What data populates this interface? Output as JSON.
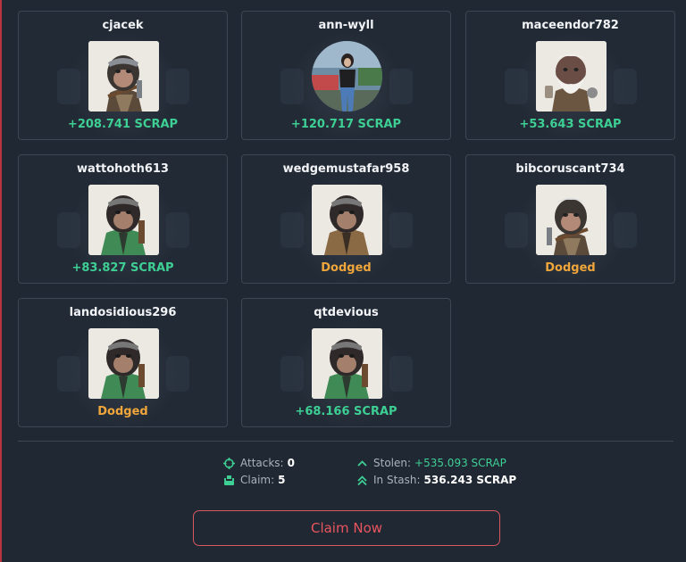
{
  "attackers": [
    {
      "username": "cjacek",
      "result": "+208.741 SCRAP",
      "status": "gain",
      "avatar": "ape-pilot-icon"
    },
    {
      "username": "ann-wyll",
      "result": "+120.717 SCRAP",
      "status": "gain",
      "avatar": "photo-avatar-icon"
    },
    {
      "username": "maceendor782",
      "result": "+53.643 SCRAP",
      "status": "gain",
      "avatar": "ape-elder-icon"
    },
    {
      "username": "wattohoth613",
      "result": "+83.827 SCRAP",
      "status": "gain",
      "avatar": "ape-green-jacket-icon"
    },
    {
      "username": "wedgemustafar958",
      "result": "Dodged",
      "status": "dodged",
      "avatar": "ape-brown-coat-icon"
    },
    {
      "username": "bibcoruscant734",
      "result": "Dodged",
      "status": "dodged",
      "avatar": "ape-pilot-icon"
    },
    {
      "username": "landosidious296",
      "result": "Dodged",
      "status": "dodged",
      "avatar": "ape-green-jacket-icon"
    },
    {
      "username": "qtdevious",
      "result": "+68.166 SCRAP",
      "status": "gain",
      "avatar": "ape-green-jacket-icon"
    }
  ],
  "summary": {
    "attacks_label": "Attacks:",
    "attacks_value": "0",
    "claim_label": "Claim:",
    "claim_value": "5",
    "stolen_label": "Stolen:",
    "stolen_value": "+535.093 SCRAP",
    "stash_label": "In Stash:",
    "stash_value": "536.243 SCRAP"
  },
  "claim_button_label": "Claim Now",
  "colors": {
    "gain": "#3ecf94",
    "dodged": "#f0a63a",
    "accent": "#e9555e",
    "background": "#202833"
  }
}
